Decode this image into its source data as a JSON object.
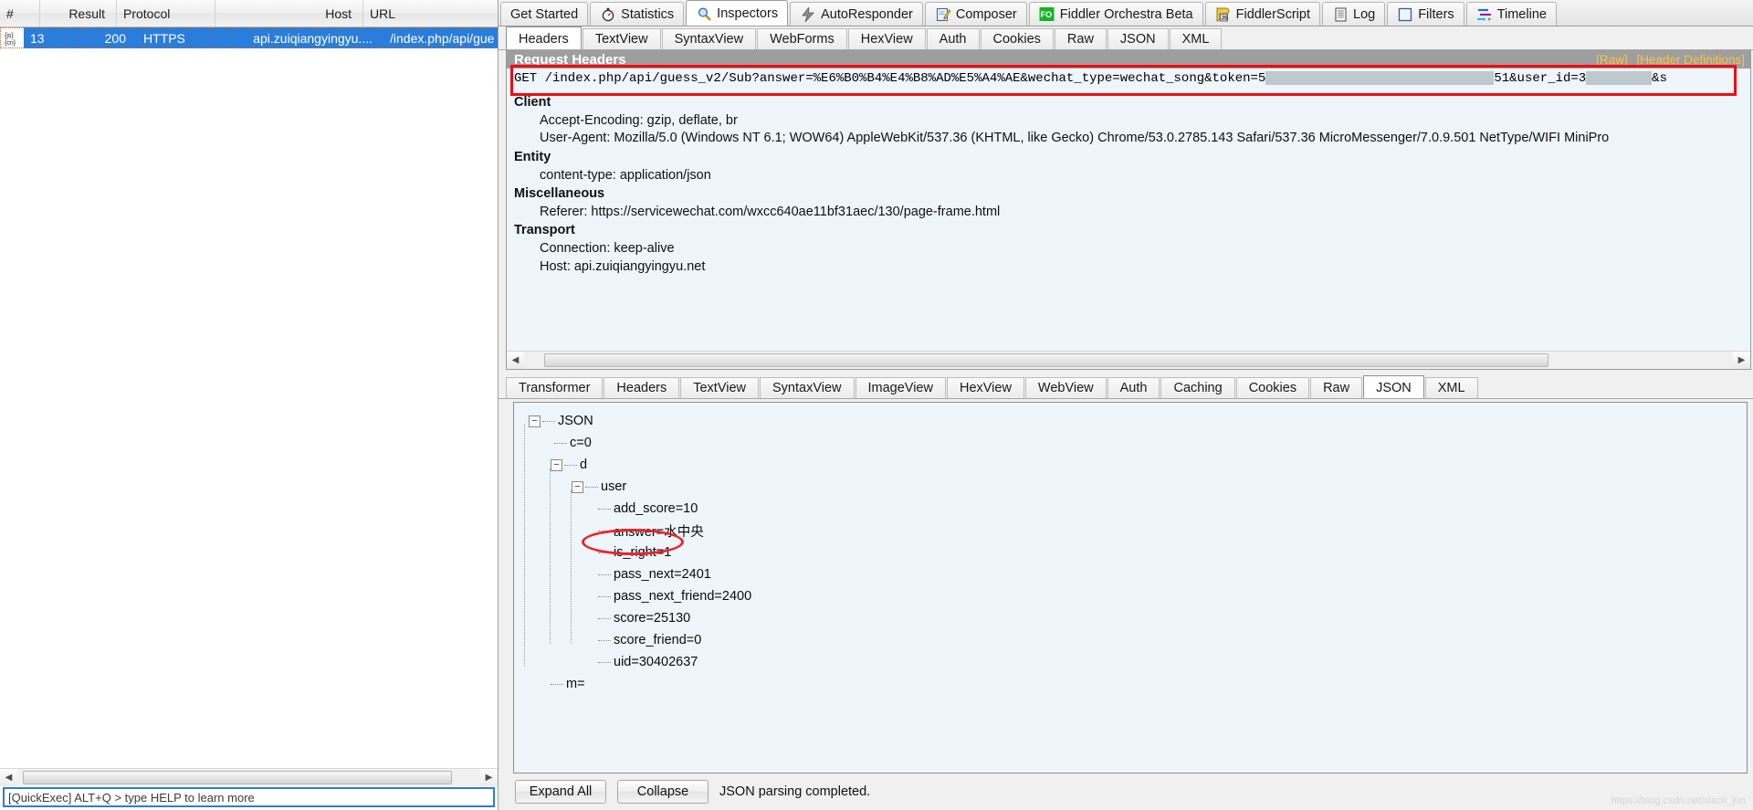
{
  "session_list": {
    "columns": [
      "#",
      "Result",
      "Protocol",
      "Host",
      "URL"
    ],
    "rows": [
      {
        "icon": "json-cn-icon",
        "num": "13",
        "result": "200",
        "protocol": "HTTPS",
        "host": "api.zuiqiangyingyu....",
        "url": "/index.php/api/gue"
      }
    ]
  },
  "quickexec": {
    "text": "[QuickExec] ALT+Q > type HELP to learn more"
  },
  "main_tabs": [
    {
      "label": "Get Started",
      "icon": "none",
      "active": false
    },
    {
      "label": "Statistics",
      "icon": "stopwatch-icon",
      "active": false
    },
    {
      "label": "Inspectors",
      "icon": "magnifier-icon",
      "active": true
    },
    {
      "label": "AutoResponder",
      "icon": "lightning-icon",
      "active": false
    },
    {
      "label": "Composer",
      "icon": "pencil-note-icon",
      "active": false
    },
    {
      "label": "Fiddler Orchestra Beta",
      "icon": "fo-badge-icon",
      "active": false
    },
    {
      "label": "FiddlerScript",
      "icon": "js-script-icon",
      "active": false
    },
    {
      "label": "Log",
      "icon": "log-icon",
      "active": false
    },
    {
      "label": "Filters",
      "icon": "filters-icon",
      "active": false
    },
    {
      "label": "Timeline",
      "icon": "timeline-icon",
      "active": false
    }
  ],
  "request_tabs": [
    {
      "label": "Headers",
      "active": true
    },
    {
      "label": "TextView",
      "active": false
    },
    {
      "label": "SyntaxView",
      "active": false
    },
    {
      "label": "WebForms",
      "active": false
    },
    {
      "label": "HexView",
      "active": false
    },
    {
      "label": "Auth",
      "active": false
    },
    {
      "label": "Cookies",
      "active": false
    },
    {
      "label": "Raw",
      "active": false
    },
    {
      "label": "JSON",
      "active": false
    },
    {
      "label": "XML",
      "active": false
    }
  ],
  "request_panel": {
    "title": "Request Headers",
    "links": [
      "[Raw]",
      "[Header Definitions]"
    ],
    "request_line_prefix": "GET /index.php/api/guess_v2/Sub?answer=%E6%B0%B4%E4%B8%AD%E5%A4%AE&wechat_type=wechat_song&token=5",
    "request_line_mid": "51&user_id=3",
    "request_line_suffix": "&s",
    "groups": [
      {
        "name": "Client",
        "lines": [
          "Accept-Encoding: gzip, deflate, br",
          "User-Agent: Mozilla/5.0 (Windows NT 6.1; WOW64) AppleWebKit/537.36 (KHTML, like Gecko) Chrome/53.0.2785.143 Safari/537.36 MicroMessenger/7.0.9.501 NetType/WIFI MiniPro"
        ]
      },
      {
        "name": "Entity",
        "lines": [
          "content-type: application/json"
        ]
      },
      {
        "name": "Miscellaneous",
        "lines": [
          "Referer: https://servicewechat.com/wxcc640ae11bf31aec/130/page-frame.html"
        ]
      },
      {
        "name": "Transport",
        "lines": [
          "Connection: keep-alive",
          "Host: api.zuiqiangyingyu.net"
        ]
      }
    ]
  },
  "response_tabs": [
    {
      "label": "Transformer",
      "active": false
    },
    {
      "label": "Headers",
      "active": false
    },
    {
      "label": "TextView",
      "active": false
    },
    {
      "label": "SyntaxView",
      "active": false
    },
    {
      "label": "ImageView",
      "active": false
    },
    {
      "label": "HexView",
      "active": false
    },
    {
      "label": "WebView",
      "active": false
    },
    {
      "label": "Auth",
      "active": false
    },
    {
      "label": "Caching",
      "active": false
    },
    {
      "label": "Cookies",
      "active": false
    },
    {
      "label": "Raw",
      "active": false
    },
    {
      "label": "JSON",
      "active": true
    },
    {
      "label": "XML",
      "active": false
    }
  ],
  "json_tree": [
    {
      "depth": 0,
      "label": "JSON",
      "expander": "minus"
    },
    {
      "depth": 1,
      "label": "c=0",
      "expander": "leaf"
    },
    {
      "depth": 1,
      "label": "d",
      "expander": "minus"
    },
    {
      "depth": 2,
      "label": "user",
      "expander": "minus"
    },
    {
      "depth": 3,
      "label": "add_score=10",
      "expander": "leaf"
    },
    {
      "depth": 3,
      "label": "answer=水中央",
      "expander": "leaf"
    },
    {
      "depth": 3,
      "label": "is_right=1",
      "expander": "leaf",
      "highlighted": true
    },
    {
      "depth": 3,
      "label": "pass_next=2401",
      "expander": "leaf"
    },
    {
      "depth": 3,
      "label": "pass_next_friend=2400",
      "expander": "leaf"
    },
    {
      "depth": 3,
      "label": "score=25130",
      "expander": "leaf"
    },
    {
      "depth": 3,
      "label": "score_friend=0",
      "expander": "leaf"
    },
    {
      "depth": 3,
      "label": "uid=30402637",
      "expander": "leaf"
    },
    {
      "depth": 1,
      "label": "m=",
      "expander": "leaf"
    }
  ],
  "response_footer": {
    "expand_all": "Expand All",
    "collapse": "Collapse",
    "status": "JSON parsing completed."
  },
  "watermark": "https://blog.csdn.net/xiaoli_jun",
  "colors": {
    "selection_blue": "#2a7ddb",
    "annotation_red": "#f10b10",
    "panel_bg": "#eef5fb",
    "title_gray": "#9e9e9e",
    "link_yellow": "#f5c542"
  }
}
